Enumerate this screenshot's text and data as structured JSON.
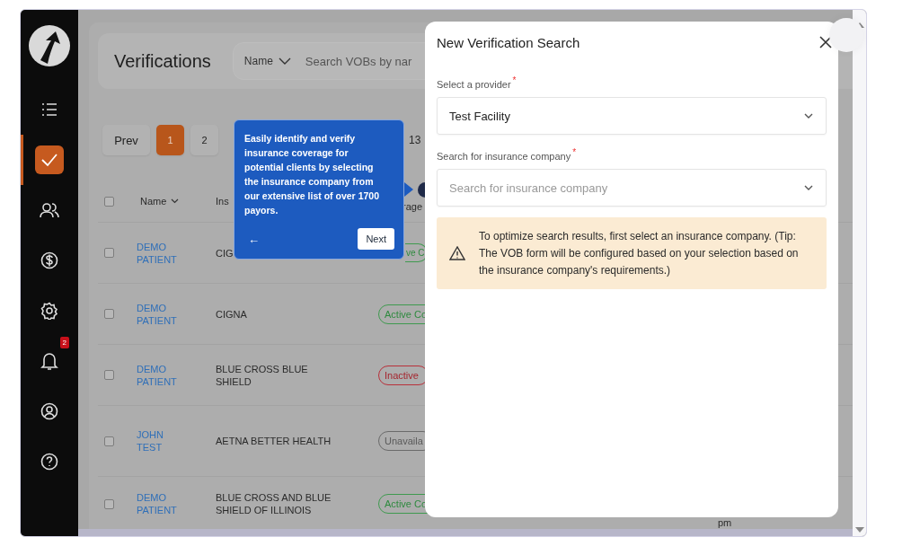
{
  "sidebar": {
    "items": [
      {
        "kind": "list",
        "selected": false
      },
      {
        "kind": "check",
        "selected": true
      },
      {
        "kind": "users",
        "selected": false
      },
      {
        "kind": "dollar",
        "selected": false
      },
      {
        "kind": "gear",
        "selected": false
      },
      {
        "kind": "bell",
        "selected": false,
        "badge": "2"
      },
      {
        "kind": "account",
        "selected": false
      },
      {
        "kind": "help",
        "selected": false
      }
    ]
  },
  "page": {
    "title": "Verifications",
    "search": {
      "filter": "Name",
      "placeholder": "Search VOBs by nar"
    }
  },
  "pagination": {
    "prev": "Prev",
    "pages": [
      {
        "label": "1",
        "selected": true
      },
      {
        "label": "2",
        "selected": false
      }
    ],
    "total": "13"
  },
  "table": {
    "columns": [
      {
        "label": "Name",
        "sortable": true
      },
      {
        "label": "Ins"
      },
      {
        "label": "rage"
      }
    ],
    "header_checked": false,
    "rows": [
      {
        "name": "DEMO PATIENT",
        "insurance": "CIG",
        "status": {
          "label": "ve C",
          "kind": "active"
        },
        "checked": false
      },
      {
        "name": "DEMO PATIENT",
        "insurance": "CIGNA",
        "status": {
          "label": "Active Co",
          "kind": "active"
        },
        "checked": false
      },
      {
        "name": "DEMO PATIENT",
        "insurance": "BLUE CROSS BLUE SHIELD",
        "status": {
          "label": "Inactive",
          "kind": "inactive"
        },
        "checked": false
      },
      {
        "name": "JOHN TEST",
        "insurance": "AETNA BETTER HEALTH",
        "status": {
          "label": "Unavaila",
          "kind": "unavailable"
        },
        "checked": false
      },
      {
        "name": "DEMO PATIENT",
        "insurance": "BLUE CROSS AND BLUE SHIELD OF ILLINOIS",
        "status": {
          "label": "Active Co",
          "kind": "active"
        },
        "checked": false,
        "time": "pm"
      }
    ]
  },
  "tooltip": {
    "text": "Easily identify and verify insurance coverage for potential clients by selecting the insurance company from our extensive list of over 1700 payors.",
    "back": "←",
    "next": "Next"
  },
  "modal": {
    "title": "New Verification Search",
    "fields": [
      {
        "label": "Select a provider",
        "required_mark": "*",
        "value": "Test Facility"
      },
      {
        "label": "Search for insurance company",
        "required_mark": "*",
        "placeholder": "Search for insurance company"
      }
    ],
    "alert": "To optimize search results, first select an insurance company. (Tip: The VOB form will be configured based on your selection based on the insurance company's requirements.)"
  }
}
